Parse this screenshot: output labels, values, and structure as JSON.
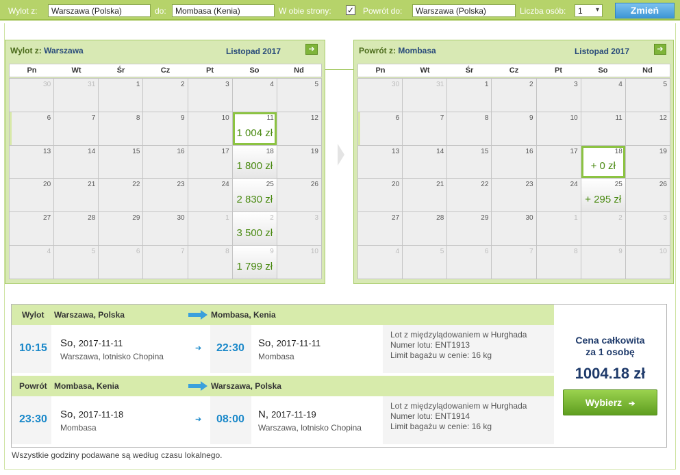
{
  "search": {
    "from_label": "Wylot z:",
    "from_value": "Warszawa (Polska)",
    "to_label": "do:",
    "to_value": "Mombasa (Kenia)",
    "roundtrip_label": "W obie strony:",
    "roundtrip_checked": "✓",
    "return_label": "Powrót do:",
    "return_value": "Warszawa (Polska)",
    "persons_label": "Liczba osób:",
    "persons_value": "1",
    "submit_label": "Zmień"
  },
  "calendars": {
    "outbound": {
      "title_prefix": "Wylot z:",
      "title_city": "Warszawa",
      "month": "Listopad 2017",
      "weekdays": [
        "Pn",
        "Wt",
        "Śr",
        "Cz",
        "Pt",
        "So",
        "Nd"
      ],
      "days": [
        {
          "d": "30",
          "o": 1
        },
        {
          "d": "31",
          "o": 1
        },
        {
          "d": "1"
        },
        {
          "d": "2"
        },
        {
          "d": "3"
        },
        {
          "d": "4"
        },
        {
          "d": "5"
        },
        {
          "d": "6",
          "hl": 1
        },
        {
          "d": "7"
        },
        {
          "d": "8"
        },
        {
          "d": "9"
        },
        {
          "d": "10"
        },
        {
          "d": "11",
          "p": "1 004 zł",
          "sel": 1
        },
        {
          "d": "12"
        },
        {
          "d": "13"
        },
        {
          "d": "14"
        },
        {
          "d": "15"
        },
        {
          "d": "16"
        },
        {
          "d": "17"
        },
        {
          "d": "18",
          "p": "1 800 zł"
        },
        {
          "d": "19"
        },
        {
          "d": "20"
        },
        {
          "d": "21"
        },
        {
          "d": "22"
        },
        {
          "d": "23"
        },
        {
          "d": "24"
        },
        {
          "d": "25",
          "p": "2 830 zł"
        },
        {
          "d": "26"
        },
        {
          "d": "27"
        },
        {
          "d": "28"
        },
        {
          "d": "29"
        },
        {
          "d": "30"
        },
        {
          "d": "1",
          "o": 1
        },
        {
          "d": "2",
          "o": 1,
          "p": "3 500 zł"
        },
        {
          "d": "3",
          "o": 1
        },
        {
          "d": "4",
          "o": 1
        },
        {
          "d": "5",
          "o": 1
        },
        {
          "d": "6",
          "o": 1
        },
        {
          "d": "7",
          "o": 1
        },
        {
          "d": "8",
          "o": 1
        },
        {
          "d": "9",
          "o": 1,
          "p": "1 799 zł"
        },
        {
          "d": "10",
          "o": 1
        }
      ]
    },
    "return": {
      "title_prefix": "Powrót z:",
      "title_city": "Mombasa",
      "month": "Listopad 2017",
      "weekdays": [
        "Pn",
        "Wt",
        "Śr",
        "Cz",
        "Pt",
        "So",
        "Nd"
      ],
      "days": [
        {
          "d": "30",
          "o": 1
        },
        {
          "d": "31",
          "o": 1
        },
        {
          "d": "1"
        },
        {
          "d": "2"
        },
        {
          "d": "3"
        },
        {
          "d": "4"
        },
        {
          "d": "5"
        },
        {
          "d": "6",
          "hl": 1
        },
        {
          "d": "7"
        },
        {
          "d": "8"
        },
        {
          "d": "9"
        },
        {
          "d": "10"
        },
        {
          "d": "11"
        },
        {
          "d": "12"
        },
        {
          "d": "13"
        },
        {
          "d": "14"
        },
        {
          "d": "15"
        },
        {
          "d": "16"
        },
        {
          "d": "17"
        },
        {
          "d": "18",
          "p": "+ 0 zł",
          "sel": 1
        },
        {
          "d": "19"
        },
        {
          "d": "20"
        },
        {
          "d": "21"
        },
        {
          "d": "22"
        },
        {
          "d": "23"
        },
        {
          "d": "24"
        },
        {
          "d": "25",
          "p": "+ 295 zł"
        },
        {
          "d": "26"
        },
        {
          "d": "27"
        },
        {
          "d": "28"
        },
        {
          "d": "29"
        },
        {
          "d": "30"
        },
        {
          "d": "1",
          "o": 1
        },
        {
          "d": "2",
          "o": 1
        },
        {
          "d": "3",
          "o": 1
        },
        {
          "d": "4",
          "o": 1
        },
        {
          "d": "5",
          "o": 1
        },
        {
          "d": "6",
          "o": 1
        },
        {
          "d": "7",
          "o": 1
        },
        {
          "d": "8",
          "o": 1
        },
        {
          "d": "9",
          "o": 1
        },
        {
          "d": "10",
          "o": 1
        }
      ]
    }
  },
  "summary": {
    "outbound": {
      "label": "Wylot",
      "from": "Warszawa, Polska",
      "to": "Mombasa, Kenia",
      "dep_time": "10:15",
      "dep_day": "So,",
      "dep_date": "2017-11-11",
      "dep_place": "Warszawa, lotnisko Chopina",
      "arr_time": "22:30",
      "arr_day": "So,",
      "arr_date": "2017-11-11",
      "arr_place": "Mombasa",
      "info1": "Lot z międzylądowaniem w Hurghada",
      "info2": "Numer lotu: ENT1913",
      "info3": "Limit bagażu w cenie: 16 kg"
    },
    "return": {
      "label": "Powrót",
      "from": "Mombasa, Kenia",
      "to": "Warszawa, Polska",
      "dep_time": "23:30",
      "dep_day": "So,",
      "dep_date": "2017-11-18",
      "dep_place": "Mombasa",
      "arr_time": "08:00",
      "arr_day": "N,",
      "arr_date": "2017-11-19",
      "arr_place": "Warszawa, lotnisko Chopina",
      "info1": "Lot z międzylądowaniem w Hurghada",
      "info2": "Numer lotu: ENT1914",
      "info3": "Limit bagażu w cenie: 16 kg"
    },
    "price_caption_1": "Cena całkowita",
    "price_caption_2": "za 1 osobę",
    "price_total": "1004.18 zł",
    "select_label": "Wybierz",
    "select_arrow": "➔"
  },
  "footnote": "Wszystkie godziny podawane są według czasu lokalnego.",
  "icons": {
    "next_month": "➔",
    "small_arrow": "➔"
  },
  "colors": {
    "accent_green": "#b6d36a",
    "price_green": "#4a8a12",
    "time_blue": "#1a88c9",
    "button_blue": "#3d96d6"
  }
}
